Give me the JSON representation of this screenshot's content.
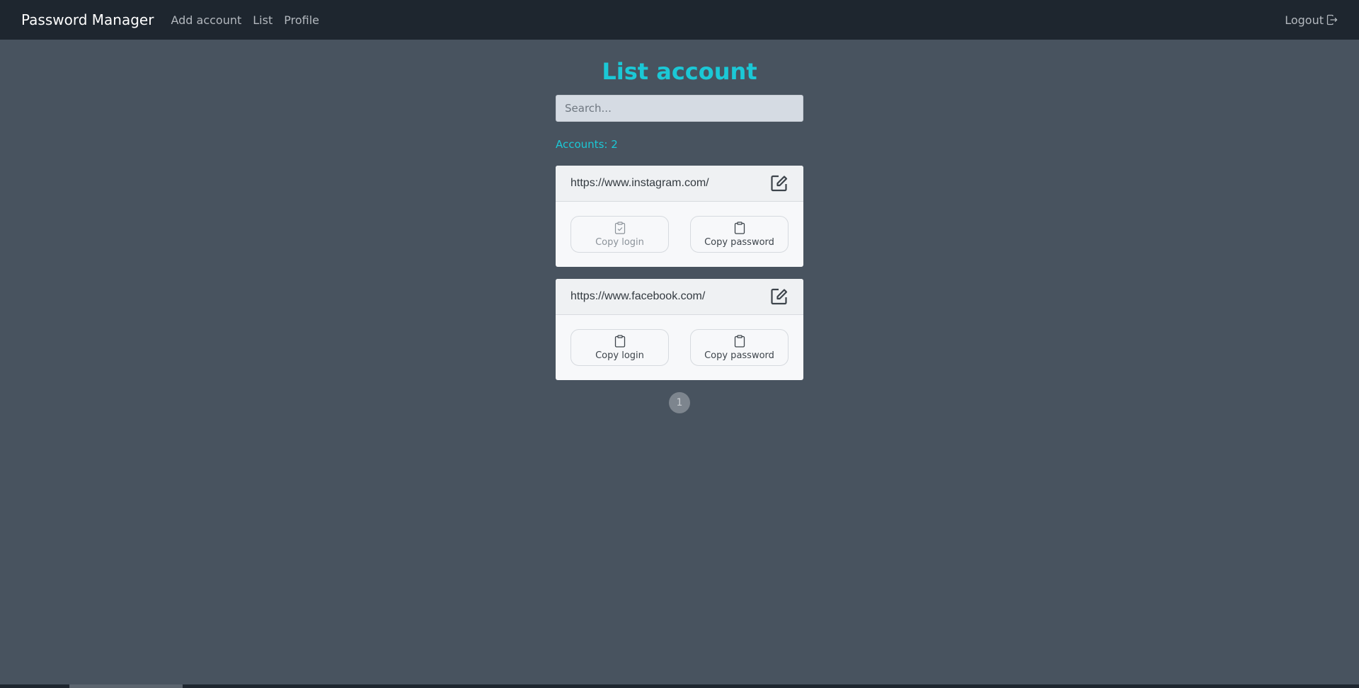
{
  "nav": {
    "brand": "Password Manager",
    "links": [
      "Add account",
      "List",
      "Profile"
    ],
    "logout": "Logout"
  },
  "page": {
    "title": "List account",
    "search_placeholder": "Search...",
    "count_label": "Accounts: 2"
  },
  "accounts": [
    {
      "url": "https://www.instagram.com/",
      "copy_login": "Copy login",
      "copy_password": "Copy password"
    },
    {
      "url": "https://www.facebook.com/",
      "copy_login": "Copy login",
      "copy_password": "Copy password"
    }
  ],
  "pagination": {
    "current": "1"
  },
  "colors": {
    "accent": "#1bc8d6",
    "background": "#48535f",
    "navbar": "#1e262f"
  },
  "icons": {
    "logout": "box-arrow-right-icon",
    "edit": "pencil-square-icon",
    "copy": "clipboard-icon",
    "copied": "clipboard-check-icon"
  }
}
